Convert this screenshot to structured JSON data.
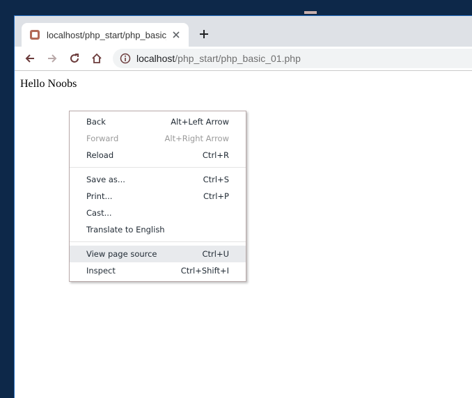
{
  "tab": {
    "title": "localhost/php_start/php_basic_01",
    "close_icon": "close-icon",
    "favicon": "wamp-favicon-icon"
  },
  "new_tab": {
    "icon": "plus-icon"
  },
  "toolbar": {
    "back_icon": "arrow-left-icon",
    "forward_icon": "arrow-right-icon",
    "reload_icon": "reload-icon",
    "home_icon": "home-icon"
  },
  "address": {
    "info_icon": "info-icon",
    "host": "localhost",
    "path": "/php_start/php_basic_01.php"
  },
  "page": {
    "text": "Hello Noobs"
  },
  "context_menu": {
    "items": [
      {
        "label": "Back",
        "shortcut": "Alt+Left Arrow"
      },
      {
        "label": "Forward",
        "shortcut": "Alt+Right Arrow",
        "disabled": true
      },
      {
        "label": "Reload",
        "shortcut": "Ctrl+R"
      },
      {
        "label": "Save as...",
        "shortcut": "Ctrl+S"
      },
      {
        "label": "Print...",
        "shortcut": "Ctrl+P"
      },
      {
        "label": "Cast...",
        "shortcut": ""
      },
      {
        "label": "Translate to English",
        "shortcut": ""
      },
      {
        "label": "View page source",
        "shortcut": "Ctrl+U",
        "highlighted": true
      },
      {
        "label": "Inspect",
        "shortcut": "Ctrl+Shift+I"
      }
    ]
  },
  "colors": {
    "desktop": "#0d2849",
    "accent_border": "#2a72c4",
    "tab_strip": "#dee1e6",
    "menu_hover": "#e8eaed"
  }
}
